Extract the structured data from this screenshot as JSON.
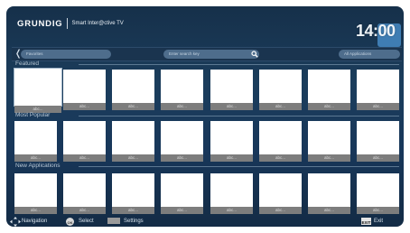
{
  "header": {
    "brand": "GRUNDIG",
    "product": "Smart Inter@ctive TV",
    "clock": "14:00"
  },
  "search_bar": {
    "left_arrow": "❬",
    "right_arrow": "❭",
    "favorites_label": "Favorites",
    "search_placeholder": "Enter search key",
    "category_label": "All Applications"
  },
  "sections": [
    {
      "title": "Featured",
      "tiles": [
        "abc...",
        "abc...",
        "abc...",
        "abc...",
        "abc...",
        "abc...",
        "abc...",
        "abc..."
      ]
    },
    {
      "title": "Most Popular",
      "tiles": [
        "abc...",
        "abc...",
        "abc...",
        "abc...",
        "abc...",
        "abc...",
        "abc...",
        "abc..."
      ]
    },
    {
      "title": "New Applications",
      "tiles": [
        "abc...",
        "abc...",
        "abc...",
        "abc...",
        "abc...",
        "abc...",
        "abc...",
        "abc..."
      ]
    }
  ],
  "footer": {
    "navigation": "Navigation",
    "ok_key": "OK",
    "select": "Select",
    "settings": "Settings",
    "exit_key": "EXIT",
    "exit": "Exit"
  },
  "colors": {
    "background": "#18375a",
    "tile": "#ffffff",
    "caption": "#7d7d7d",
    "clock_accent": "#3f7db3"
  }
}
